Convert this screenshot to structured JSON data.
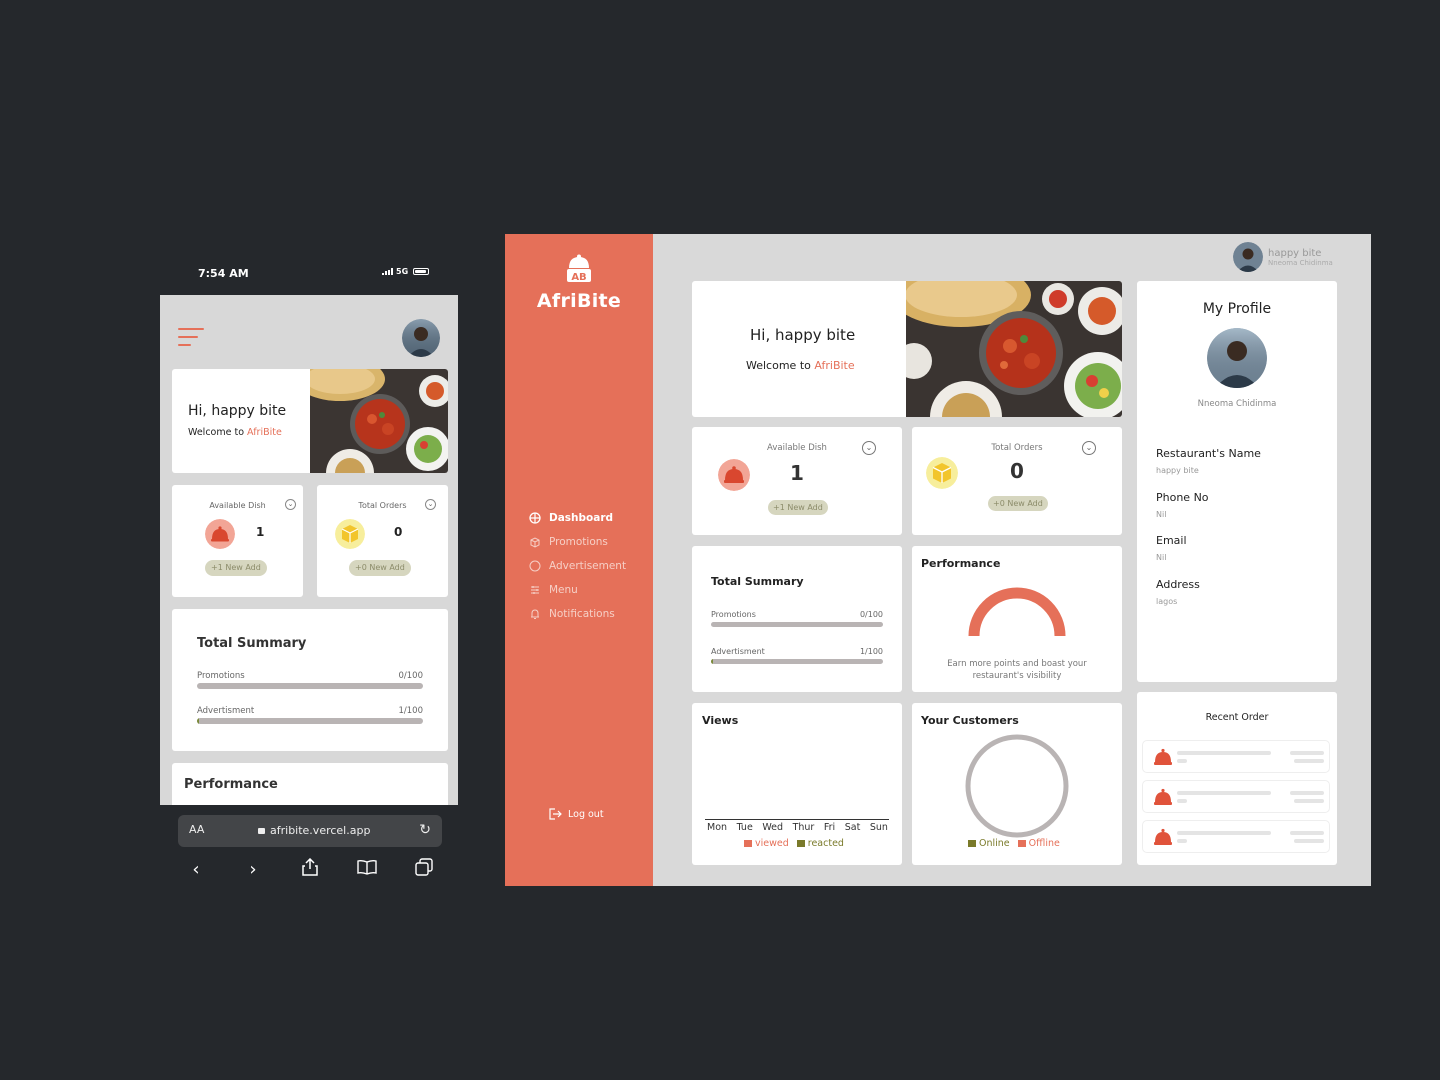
{
  "phone": {
    "time": "7:54 AM",
    "network": "5G",
    "greeting": "Hi, happy bite",
    "welcome_prefix": "Welcome to ",
    "brand": "AfriBite",
    "available_dish": {
      "label": "Available Dish",
      "value": "1",
      "pill": "+1 New Add"
    },
    "total_orders": {
      "label": "Total Orders",
      "value": "0",
      "pill": "+0 New Add"
    },
    "summary": {
      "title": "Total Summary",
      "rows": [
        {
          "name": "Promotions",
          "value": "0/100",
          "fraction": 0.0
        },
        {
          "name": "Advertisment",
          "value": "1/100",
          "fraction": 0.01
        }
      ]
    },
    "performance_title": "Performance",
    "browser": {
      "aa": "AA",
      "url": "afribite.vercel.app"
    }
  },
  "desktop": {
    "brand": "AfriBite",
    "logo_letters": "AB",
    "nav": [
      {
        "label": "Dashboard",
        "icon": "dashboard-icon",
        "active": true
      },
      {
        "label": "Promotions",
        "icon": "promotions-icon",
        "active": false
      },
      {
        "label": "Advertisement",
        "icon": "advertisement-icon",
        "active": false
      },
      {
        "label": "Menu",
        "icon": "menu-icon",
        "active": false
      },
      {
        "label": "Notifications",
        "icon": "bell-icon",
        "active": false
      }
    ],
    "logout": "Log out",
    "user": {
      "name": "happy bite",
      "subtitle": "Nneoma Chidinma"
    },
    "greeting": "Hi, happy bite",
    "welcome_prefix": "Welcome to ",
    "available_dish": {
      "label": "Available Dish",
      "value": "1",
      "pill": "+1 New Add"
    },
    "total_orders": {
      "label": "Total Orders",
      "value": "0",
      "pill": "+0 New Add"
    },
    "summary": {
      "title": "Total Summary",
      "rows": [
        {
          "name": "Promotions",
          "value": "0/100",
          "fraction": 0.0
        },
        {
          "name": "Advertisment",
          "value": "1/100",
          "fraction": 0.01
        }
      ]
    },
    "performance": {
      "title": "Performance",
      "note": "Earn more points and boast your restaurant's visibility"
    },
    "views": {
      "title": "Views",
      "days": [
        "Mon",
        "Tue",
        "Wed",
        "Thur",
        "Fri",
        "Sat",
        "Sun"
      ],
      "legend": [
        {
          "label": "viewed",
          "color": "#e57059"
        },
        {
          "label": "reacted",
          "color": "#7a7a2a"
        }
      ]
    },
    "customers": {
      "title": "Your Customers",
      "legend": [
        {
          "label": "Online",
          "color": "#7a7a2a"
        },
        {
          "label": "Offline",
          "color": "#e57059"
        }
      ]
    },
    "profile": {
      "title": "My Profile",
      "name": "Nneoma Chidinma",
      "fields": [
        {
          "key": "Restaurant's Name",
          "value": "happy bite"
        },
        {
          "key": "Phone No",
          "value": "Nil"
        },
        {
          "key": "Email",
          "value": "Nil"
        },
        {
          "key": "Address",
          "value": "lagos"
        }
      ]
    },
    "recent_order_title": "Recent Order"
  },
  "colors": {
    "accent": "#e57059",
    "olive": "#7a8a3a",
    "panel": "#d9d9d9",
    "background": "#25282c"
  }
}
